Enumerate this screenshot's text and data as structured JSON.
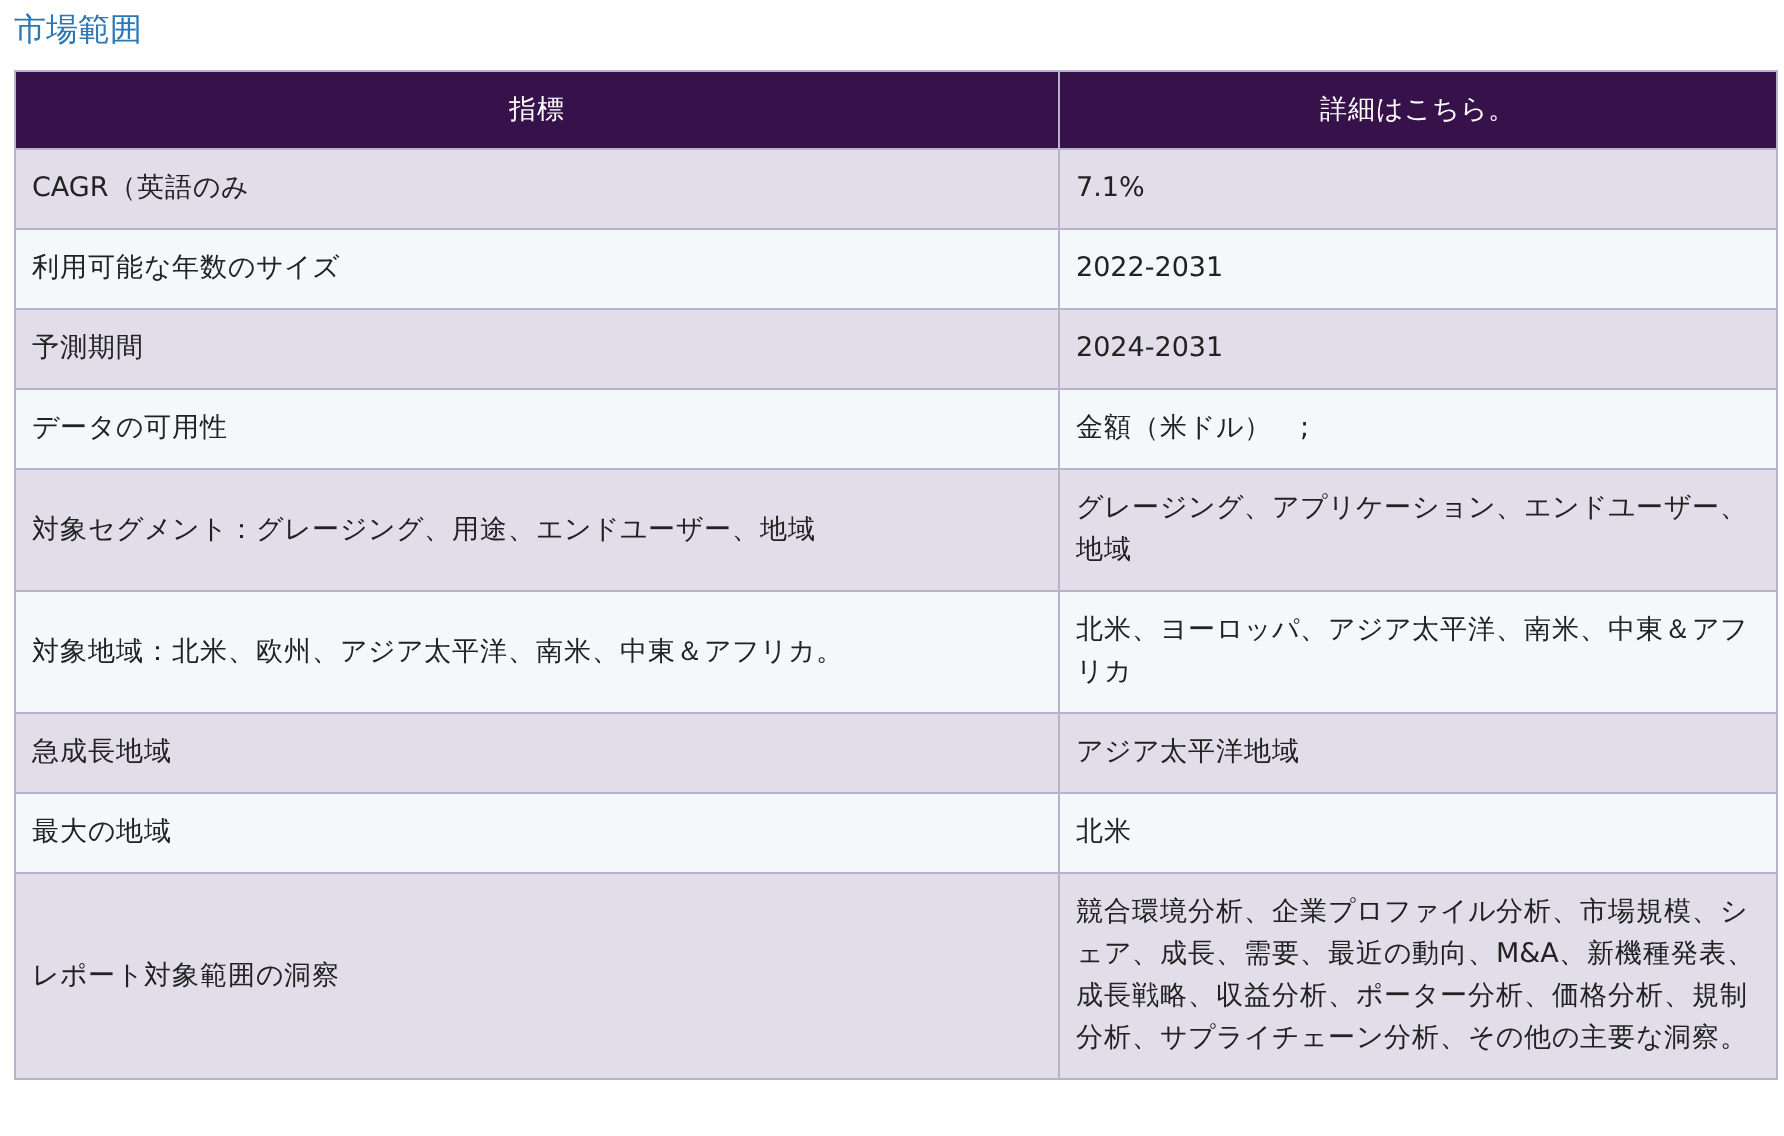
{
  "title": "市場範囲",
  "table": {
    "columns": [
      "指標",
      "詳細はこちら。"
    ],
    "rows": [
      [
        "CAGR（英語のみ",
        "7.1%"
      ],
      [
        "利用可能な年数のサイズ",
        "2022-2031"
      ],
      [
        "予測期間",
        "2024-2031"
      ],
      [
        "データの可用性",
        "金額（米ドル）　;"
      ],
      [
        "対象セグメント：グレージング、用途、エンドユーザー、地域",
        "グレージング、アプリケーション、エンドユーザー、地域"
      ],
      [
        "対象地域：北米、欧州、アジア太平洋、南米、中東＆アフリカ。",
        "北米、ヨーロッパ、アジア太平洋、南米、中東＆アフリカ"
      ],
      [
        "急成長地域",
        "アジア太平洋地域"
      ],
      [
        "最大の地域",
        "北米"
      ],
      [
        "レポート対象範囲の洞察",
        "競合環境分析、企業プロファイル分析、市場規模、シェア、成長、需要、最近の動向、M&A、新機種発表、成長戦略、収益分析、ポーター分析、価格分析、規制分析、サプライチェーン分析、その他の主要な洞察。"
      ]
    ]
  }
}
